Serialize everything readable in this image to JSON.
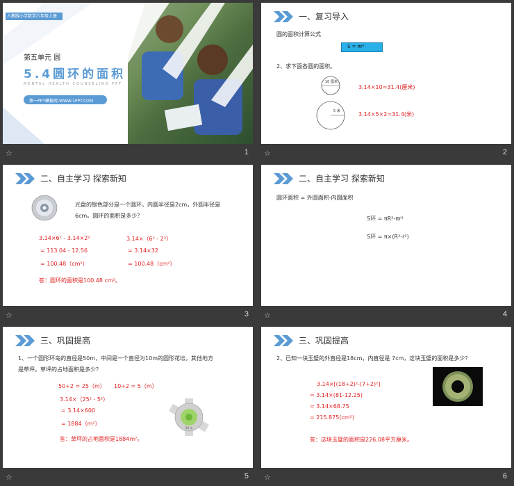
{
  "slides": [
    {
      "num": "1",
      "badge": "人教版小学数学六年级上册",
      "unit": "第五单元   圆",
      "title": "5.4圆环的面积",
      "subtitle": "MENTAL HEALTH COUNSELING PPT",
      "site": "第一PPT模板网-WWW.1PPT.COM"
    },
    {
      "num": "2",
      "heading": "一、复习导入",
      "line1": "圆的面积计算公式",
      "formula": "S = πr²",
      "line2": "2、求下面各圆的面积。",
      "circle1": "10 厘米",
      "circle2": "5 米",
      "ans1": "3.14×10=31.4(厘米)",
      "ans2": "3.14×5×2=31.4(米)"
    },
    {
      "num": "3",
      "heading": "二、自主学习  探索新知",
      "q1": "光盘的银色部分是一个圆环，内圆半径是2cm，外圆半径是",
      "q2": "6cm。圆环的面积是多少？",
      "a1": "3.14×6² - 3.14×2²",
      "a2": "= 113.04 - 12.56",
      "a3": "= 100.48（cm²）",
      "b1": "3.14×（6² - 2²）",
      "b2": "= 3.14×32",
      "b3": "= 100.48（cm²）",
      "ans": "答：圆环的面积是100.48 cm²。"
    },
    {
      "num": "4",
      "heading": "二、自主学习  探索新知",
      "l1": "圆环面积 = 外圆面积-内圆面积",
      "f1": "S环 = πR²-πr²",
      "f2": "S环 = π×(R²-r²)"
    },
    {
      "num": "5",
      "heading": "三、巩固提高",
      "q1": "1、一个圆形环岛的直径是50m，中间是一个直径为10m的圆形花坛，其他地方",
      "q2": "是草坪。草坪的占地面积是多少？",
      "s1": "50÷2 = 25（m）",
      "s1b": "10÷2 = 5（m）",
      "s2": "3.14×（25² - 5²）",
      "s3": "= 3.14×600",
      "s4": "= 1884（m²）",
      "ans": "答：草坪的占地面积是1884m²。",
      "lbl": "50 m"
    },
    {
      "num": "6",
      "heading": "三、巩固提高",
      "q1": "2、已知一块玉璧的外直径是18cm，内直径是 7cm，这块玉璧的面积是多少？",
      "s1": "3.14×[(18÷2)²-(7÷2)²]",
      "s2": "= 3.14×(81-12.25)",
      "s3": "= 3.14×68.75",
      "s4": "= 215.875(cm²)",
      "ans": "答：这块玉璧的面积是226.08平方厘米。"
    }
  ],
  "colors": {
    "accent": "#5b9bd5",
    "red": "#e02020",
    "bar": "#3a3a3a"
  }
}
